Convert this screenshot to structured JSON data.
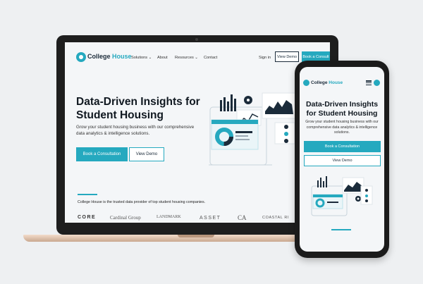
{
  "site": {
    "logo_prefix": "College ",
    "logo_suffix": "House",
    "nav": {
      "solutions": "Solutions ⌄",
      "about": "About",
      "resources": "Resources ⌄",
      "contact": "Contact",
      "signin": "Sign in",
      "view_demo": "View Demo",
      "book_consult": "Book a Consult"
    },
    "hero": {
      "title": "Data-Driven Insights for Student Housing",
      "subtitle": "Grow your student housing business with our comprehensive data analytics & intelligence solutions.",
      "primary_cta": "Book a Consultation",
      "secondary_cta": "View Demo"
    },
    "trusted_text": "College House is the trusted data provider of top student housing companies.",
    "brands": [
      "CORE",
      "Cardinal Group",
      "LANDMARK",
      "ASSET",
      "CA",
      "COASTAL RI"
    ]
  },
  "mobile": {
    "logo_prefix": "College ",
    "logo_suffix": "House",
    "hero": {
      "title": "Data-Driven Insights for Student Housing",
      "subtitle": "Grow your student housing business with our comprehensive data analytics & intelligence solutions.",
      "primary_cta": "Book a Consultation",
      "secondary_cta": "View Demo"
    }
  },
  "colors": {
    "accent": "#25a9bf",
    "dark": "#1b2b3a",
    "device": "#1e1e1e",
    "laptop_base": "#d9bca6"
  },
  "icons": [
    "logo-icon",
    "gear-icon",
    "hamburger-icon",
    "user-icon",
    "donut-chart-icon",
    "bar-chart-icon"
  ]
}
